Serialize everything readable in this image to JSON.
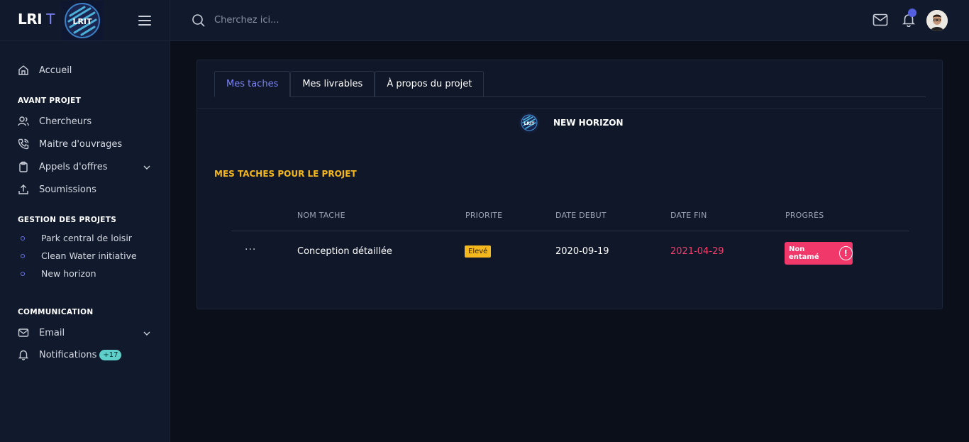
{
  "brand": {
    "name": "LRI",
    "suffix": "T",
    "logo_text": "LRIT"
  },
  "search": {
    "placeholder": "Cherchez ici..."
  },
  "sidebar": {
    "home": "Accueil",
    "avant_projet": {
      "title": "AVANT PROJET",
      "items": [
        "Chercheurs",
        "Maitre d'ouvrages",
        "Appels d'offres",
        "Soumissions"
      ]
    },
    "gestion": {
      "title": "GESTION DES PROJETS",
      "items": [
        "Park central de loisir",
        "Clean Water initiative",
        "New horizon"
      ]
    },
    "communication": {
      "title": "COMMUNICATION",
      "email": "Email",
      "notifications": "Notifications",
      "notifications_count": "+17"
    }
  },
  "tabs": [
    "Mes taches",
    "Mes livrables",
    "À propos du projet"
  ],
  "project": {
    "logo_text": "LRIT",
    "name": "NEW HORIZON"
  },
  "tasks": {
    "title": "MES TACHES POUR LE PROJET",
    "columns": [
      "NOM TACHE",
      "PRIORITE",
      "DATE DEBUT",
      "DATE FIN",
      "PROGRÈS"
    ],
    "rows": [
      {
        "menu": "···",
        "name": "Conception détaillée",
        "priority": "Elevé",
        "start": "2020-09-19",
        "end": "2021-04-29",
        "progress": "Non entamé",
        "progress_icon": "!"
      }
    ]
  },
  "colors": {
    "accent": "#7b83f5",
    "warning": "#f5b71e",
    "danger": "#f0386b",
    "info": "#5ecfc9"
  }
}
